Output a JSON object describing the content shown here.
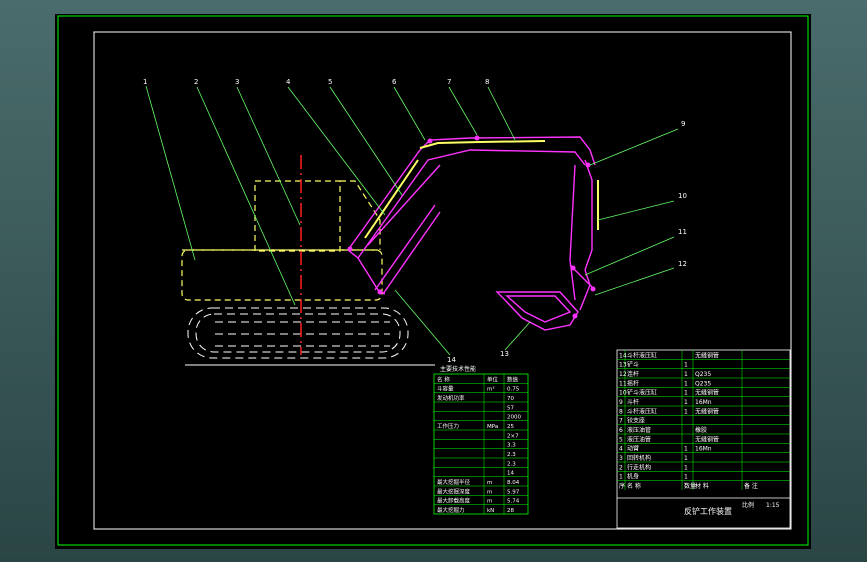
{
  "drawing": {
    "callouts": [
      "1",
      "2",
      "3",
      "4",
      "5",
      "6",
      "7",
      "8",
      "9",
      "10",
      "11",
      "12",
      "13",
      "14"
    ],
    "params_title": "主要技术性能",
    "params_header": [
      "名  称",
      "单位",
      "数值"
    ],
    "params_rows": [
      [
        "斗容量",
        "m³",
        "0.75"
      ],
      [
        "发动机功率",
        "",
        "70"
      ],
      [
        "",
        "",
        "57"
      ],
      [
        "",
        "",
        "2000"
      ],
      [
        "工作压力",
        "MPa",
        "25"
      ],
      [
        "",
        "",
        "2×7"
      ],
      [
        "",
        "",
        "3.3"
      ],
      [
        "",
        "",
        "2.3"
      ],
      [
        "",
        "",
        "2.3"
      ],
      [
        "",
        "",
        "14"
      ],
      [
        "最大挖掘半径",
        "m",
        "8.04"
      ],
      [
        "最大挖掘深度",
        "m",
        "5.97"
      ],
      [
        "最大卸载高度",
        "m",
        "5.74"
      ],
      [
        "最大挖掘力",
        "kN",
        "28"
      ]
    ],
    "bom_rows": [
      [
        "14",
        "斗杆液压缸",
        "",
        "无缝钢管",
        ""
      ],
      [
        "13",
        "铲斗",
        "1",
        "",
        ""
      ],
      [
        "12",
        "连杆",
        "1",
        "Q235",
        ""
      ],
      [
        "11",
        "摇杆",
        "1",
        "Q235",
        ""
      ],
      [
        "10",
        "铲斗液压缸",
        "1",
        "无缝钢管",
        ""
      ],
      [
        "9",
        "斗杆",
        "1",
        "16Mn",
        ""
      ],
      [
        "8",
        "斗杆液压缸",
        "1",
        "无缝钢管",
        ""
      ],
      [
        "7",
        "铰支座",
        "",
        "",
        ""
      ],
      [
        "6",
        "液压油管",
        "",
        "橡胶",
        ""
      ],
      [
        "5",
        "液压油管",
        "",
        "无缝钢管",
        ""
      ],
      [
        "4",
        "动臂",
        "1",
        "16Mn",
        ""
      ],
      [
        "3",
        "回转机构",
        "1",
        "",
        ""
      ],
      [
        "2",
        "行走机构",
        "1",
        "",
        ""
      ],
      [
        "1",
        "机身",
        "1",
        "",
        ""
      ]
    ],
    "bom_header": [
      "序",
      "名  称",
      "数量",
      "材  料",
      "备  注"
    ],
    "title_block": {
      "drawing_name": "反铲工作装置",
      "scale_label": "比例",
      "scale": "1:15"
    }
  },
  "colors": {
    "bg_outer": "#3c5a5a",
    "sheet": "#000000",
    "border": "#00ff00",
    "machine": "#ffff66",
    "arm": "#ff33ff",
    "centerline": "#ff2020",
    "leader": "#66ff66",
    "text": "#ffffff"
  }
}
